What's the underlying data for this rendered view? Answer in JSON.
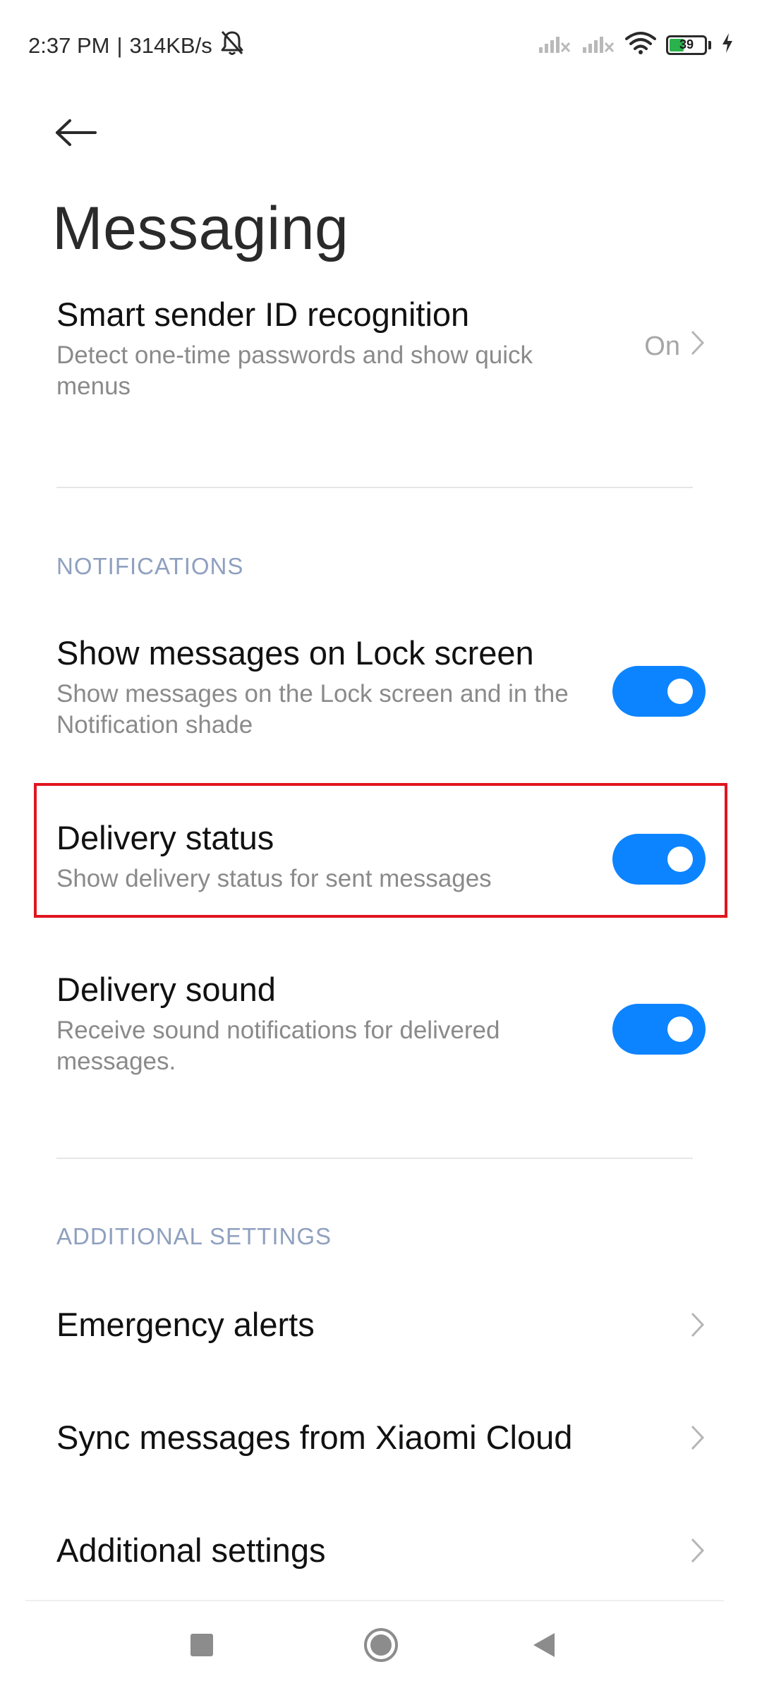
{
  "status_bar": {
    "time": "2:37 PM",
    "separator": "|",
    "network_speed": "314KB/s",
    "battery_level": "39",
    "icons": [
      "mute-bell-icon",
      "signal-x-icon",
      "signal-x-icon",
      "wifi-icon",
      "battery-icon",
      "charging-bolt-icon"
    ],
    "battery_fraction": 0.39
  },
  "header": {
    "back_icon": "back-arrow-icon",
    "title": "Messaging"
  },
  "rows": {
    "smart_sender": {
      "title": "Smart sender ID recognition",
      "subtitle": "Detect one-time passwords and show quick menus",
      "value": "On"
    },
    "show_on_lock": {
      "title": "Show messages on Lock screen",
      "subtitle": "Show messages on the Lock screen and in the Notification shade",
      "toggle_on": true
    },
    "delivery_status": {
      "title": "Delivery status",
      "subtitle": "Show delivery status for sent messages",
      "toggle_on": true
    },
    "delivery_sound": {
      "title": "Delivery sound",
      "subtitle": "Receive sound notifications for delivered messages.",
      "toggle_on": true
    },
    "emergency_alerts": {
      "title": "Emergency alerts"
    },
    "sync_cloud": {
      "title": "Sync messages from Xiaomi Cloud"
    },
    "additional": {
      "title": "Additional settings"
    }
  },
  "sections": {
    "notifications": "NOTIFICATIONS",
    "additional_settings": "ADDITIONAL SETTINGS"
  },
  "colors": {
    "accent": "#0d84ff",
    "highlight": "#e0151f",
    "section_header": "#8fa0bf"
  },
  "nav_bar": {
    "icons": [
      "recents-square-icon",
      "home-circle-icon",
      "back-triangle-icon"
    ]
  }
}
